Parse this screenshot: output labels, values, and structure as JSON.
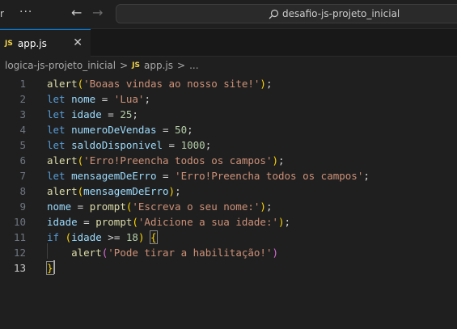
{
  "titlebar": {
    "menu_partial": "r",
    "more_glyph": "···",
    "search_text": "desafio-js-projeto_inicial"
  },
  "tab": {
    "badge": "JS",
    "label": "app.js",
    "close_glyph": "✕"
  },
  "breadcrumb": {
    "folder": "logica-js-projeto_inicial",
    "sep": ">",
    "badge": "JS",
    "file": "app.js",
    "tail": "..."
  },
  "editor": {
    "line_numbers": [
      "1",
      "2",
      "3",
      "4",
      "5",
      "6",
      "7",
      "8",
      "9",
      "10",
      "11",
      "12",
      "13"
    ],
    "active_line": 13,
    "lines": [
      [
        [
          "fn",
          "alert"
        ],
        [
          "br1",
          "("
        ],
        [
          "str",
          "'Boaas vindas ao nosso site!'"
        ],
        [
          "br1",
          ")"
        ],
        [
          "pun",
          ";"
        ]
      ],
      [
        [
          "kw",
          "let"
        ],
        [
          "pun",
          " "
        ],
        [
          "var",
          "nome"
        ],
        [
          "pun",
          " = "
        ],
        [
          "str",
          "'Lua'"
        ],
        [
          "pun",
          ";"
        ]
      ],
      [
        [
          "kw",
          "let"
        ],
        [
          "pun",
          " "
        ],
        [
          "var",
          "idade"
        ],
        [
          "pun",
          " = "
        ],
        [
          "num",
          "25"
        ],
        [
          "pun",
          ";"
        ]
      ],
      [
        [
          "kw",
          "let"
        ],
        [
          "pun",
          " "
        ],
        [
          "var",
          "numeroDeVendas"
        ],
        [
          "pun",
          " = "
        ],
        [
          "num",
          "50"
        ],
        [
          "pun",
          ";"
        ]
      ],
      [
        [
          "kw",
          "let"
        ],
        [
          "pun",
          " "
        ],
        [
          "var",
          "saldoDisponivel"
        ],
        [
          "pun",
          " = "
        ],
        [
          "num",
          "1000"
        ],
        [
          "pun",
          ";"
        ]
      ],
      [
        [
          "fn",
          "alert"
        ],
        [
          "br1",
          "("
        ],
        [
          "str",
          "'Erro!Preencha todos os campos'"
        ],
        [
          "br1",
          ")"
        ],
        [
          "pun",
          ";"
        ]
      ],
      [
        [
          "kw",
          "let"
        ],
        [
          "pun",
          " "
        ],
        [
          "var",
          "mensagemDeErro"
        ],
        [
          "pun",
          " = "
        ],
        [
          "str",
          "'Erro!Preencha todos os campos'"
        ],
        [
          "pun",
          ";"
        ]
      ],
      [
        [
          "fn",
          "alert"
        ],
        [
          "br1",
          "("
        ],
        [
          "var",
          "mensagemDeErro"
        ],
        [
          "br1",
          ")"
        ],
        [
          "pun",
          ";"
        ]
      ],
      [
        [
          "var",
          "nome"
        ],
        [
          "pun",
          " = "
        ],
        [
          "fn",
          "prompt"
        ],
        [
          "br1",
          "("
        ],
        [
          "str",
          "'Escreva o seu nome:'"
        ],
        [
          "br1",
          ")"
        ],
        [
          "pun",
          ";"
        ]
      ],
      [
        [
          "var",
          "idade"
        ],
        [
          "pun",
          " = "
        ],
        [
          "fn",
          "prompt"
        ],
        [
          "br1",
          "("
        ],
        [
          "str",
          "'Adicione a sua idade:'"
        ],
        [
          "br1",
          ")"
        ],
        [
          "pun",
          ";"
        ]
      ],
      [
        [
          "kw",
          "if"
        ],
        [
          "pun",
          " "
        ],
        [
          "br1",
          "("
        ],
        [
          "var",
          "idade"
        ],
        [
          "pun",
          " >= "
        ],
        [
          "num",
          "18"
        ],
        [
          "br1",
          ")"
        ],
        [
          "pun",
          " "
        ],
        [
          "br1m",
          "{"
        ]
      ],
      [
        [
          "pun",
          "    "
        ],
        [
          "fn",
          "alert"
        ],
        [
          "br2",
          "("
        ],
        [
          "str",
          "'Pode tirar a habilitação!'"
        ],
        [
          "br2",
          ")"
        ]
      ],
      [
        [
          "br1m",
          "}"
        ]
      ]
    ]
  }
}
